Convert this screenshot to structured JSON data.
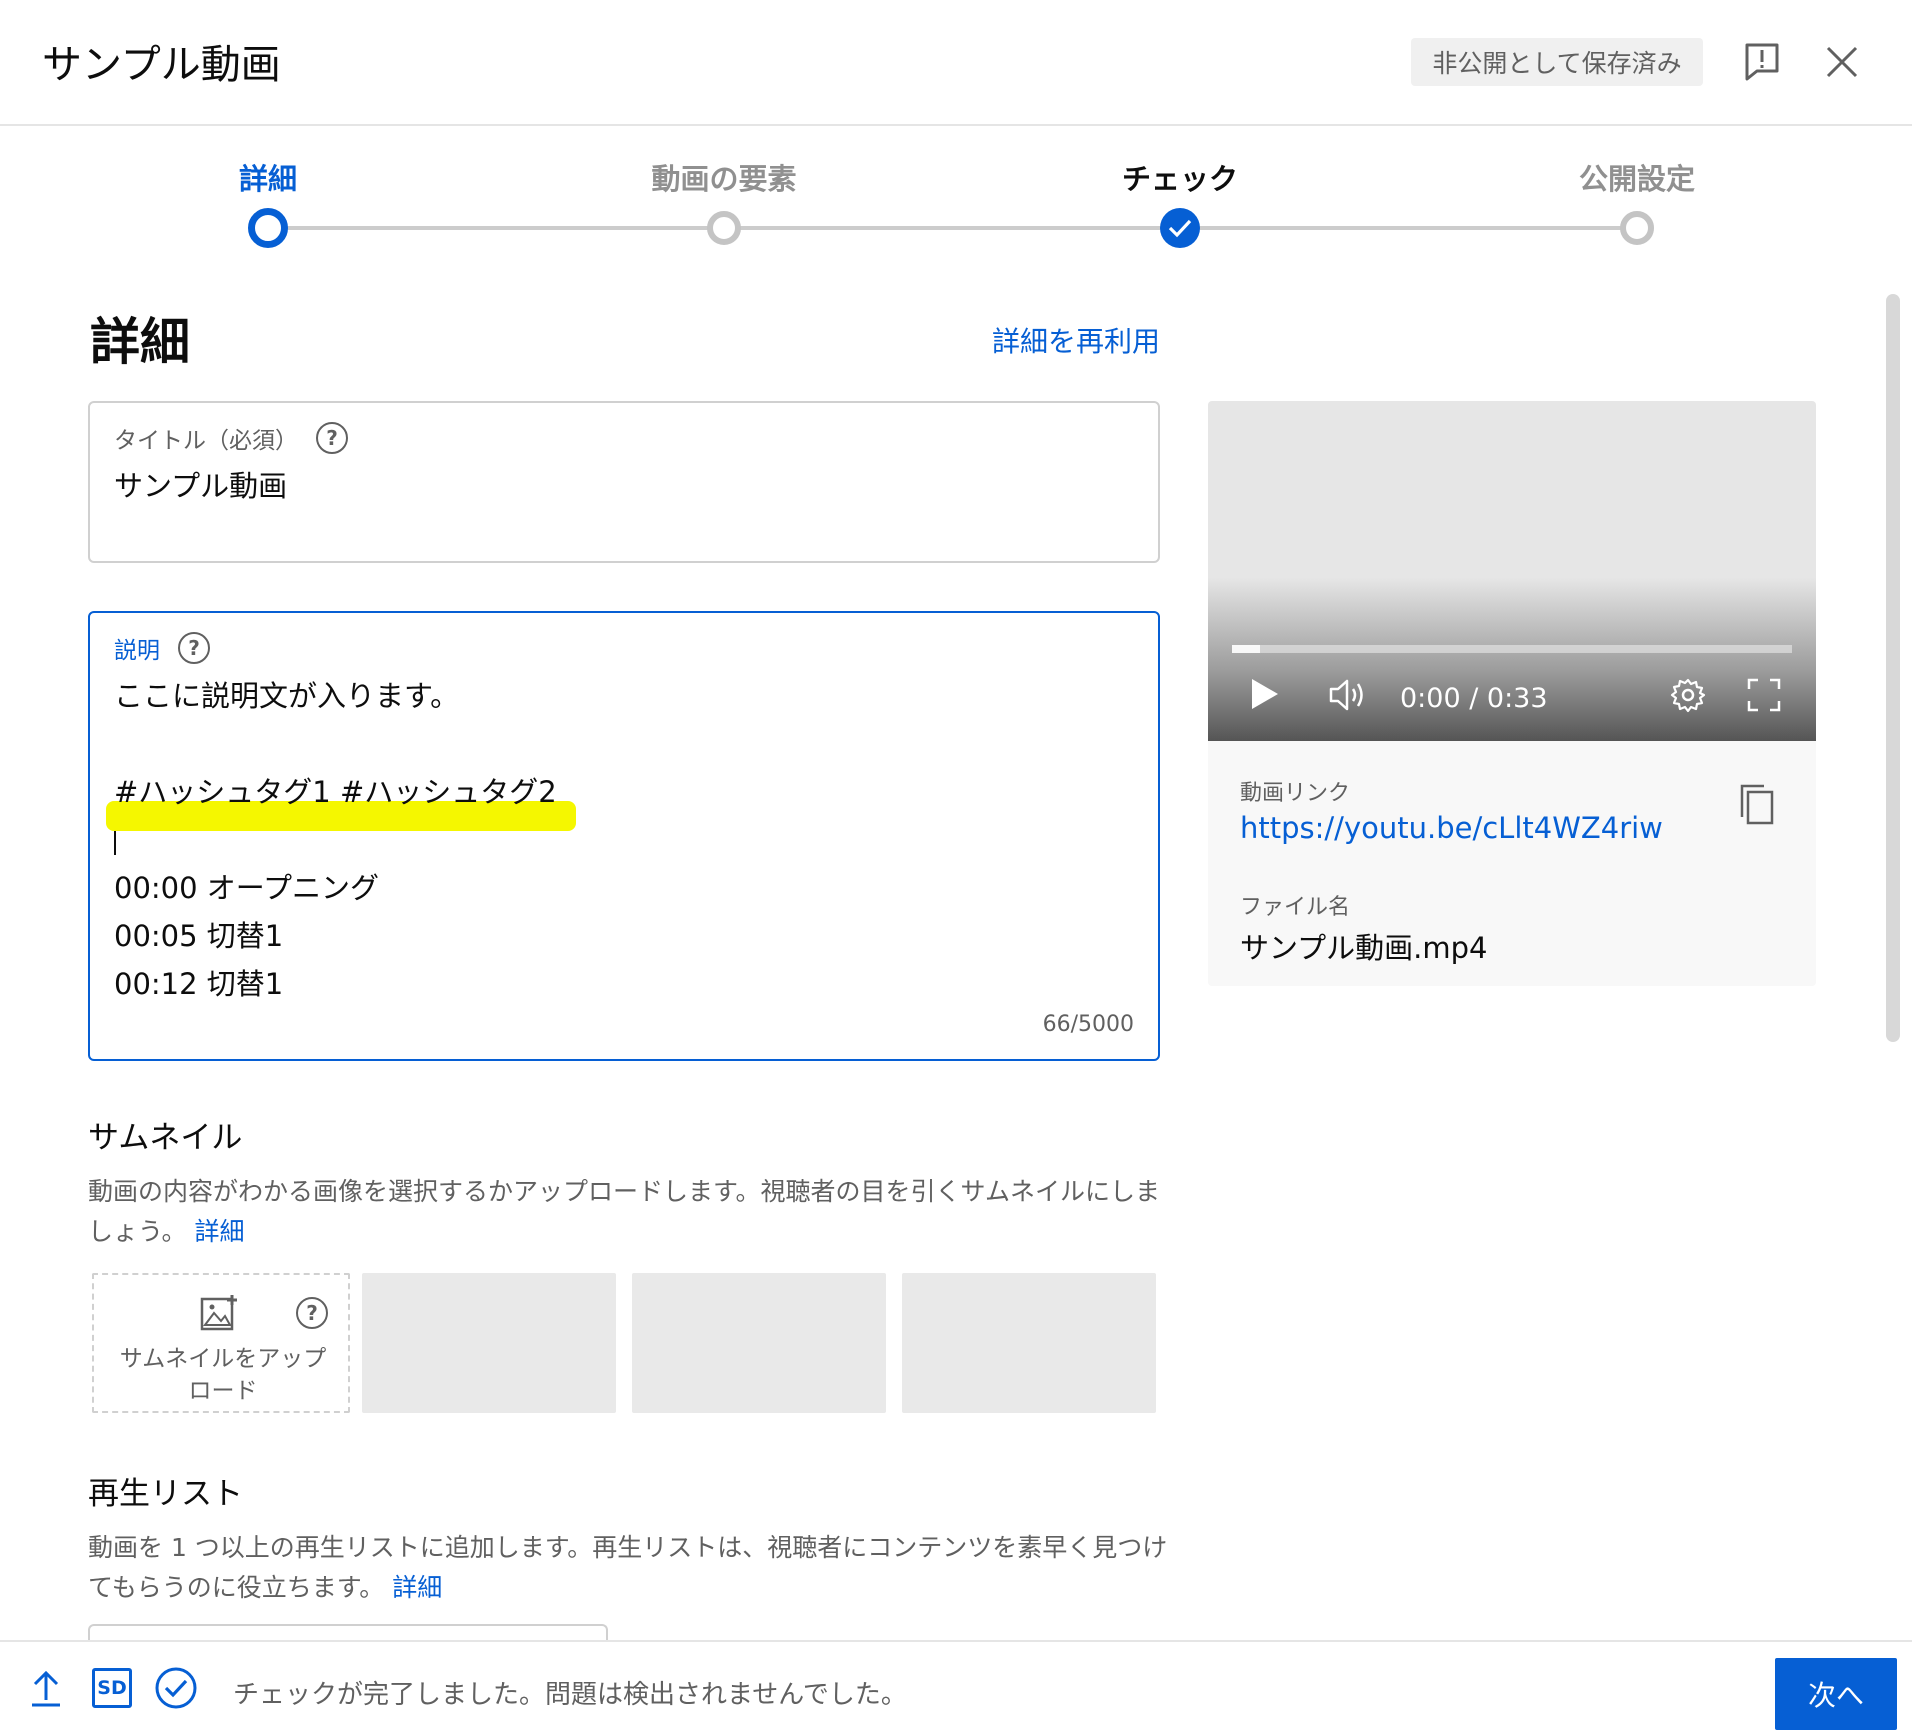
{
  "header": {
    "title": "サンプル動画",
    "saved_status": "非公開として保存済み"
  },
  "stepper": {
    "steps": [
      {
        "label": "詳細",
        "state": "active"
      },
      {
        "label": "動画の要素",
        "state": "idle"
      },
      {
        "label": "チェック",
        "state": "done"
      },
      {
        "label": "公開設定",
        "state": "idle"
      }
    ]
  },
  "details": {
    "section_title": "詳細",
    "reuse_link": "詳細を再利用",
    "title_field": {
      "label": "タイトル（必須）",
      "value": "サンプル動画"
    },
    "description_field": {
      "label": "説明",
      "lines": [
        "ここに説明文が入ります。",
        "",
        "#ハッシュタグ1 #ハッシュタグ2",
        "",
        "00:00 オープニング",
        "00:05 切替1",
        "00:12 切替1"
      ],
      "counter": "66/5000"
    }
  },
  "thumbnail": {
    "title": "サムネイル",
    "description": "動画の内容がわかる画像を選択するかアップロードします。視聴者の目を引くサムネイルにしましょう。",
    "link": "詳細",
    "upload_label_line1": "サムネイルをアップ",
    "upload_label_line2": "ロード"
  },
  "playlist": {
    "title": "再生リスト",
    "description": "動画を 1 つ以上の再生リストに追加します。再生リストは、視聴者にコンテンツを素早く見つけてもらうのに役立ちます。",
    "link": "詳細"
  },
  "video_card": {
    "time": "0:00 / 0:33",
    "progress": 0.05,
    "link_label": "動画リンク",
    "link_url": "https://youtu.be/cLlt4WZ4riw",
    "filename_label": "ファイル名",
    "filename": "サンプル動画.mp4"
  },
  "footer": {
    "status": "チェックが完了しました。問題は検出されませんでした。",
    "next_label": "次へ",
    "quality_badge": "SD"
  },
  "colors": {
    "accent": "#065fd4",
    "highlight": "#f5f700"
  }
}
